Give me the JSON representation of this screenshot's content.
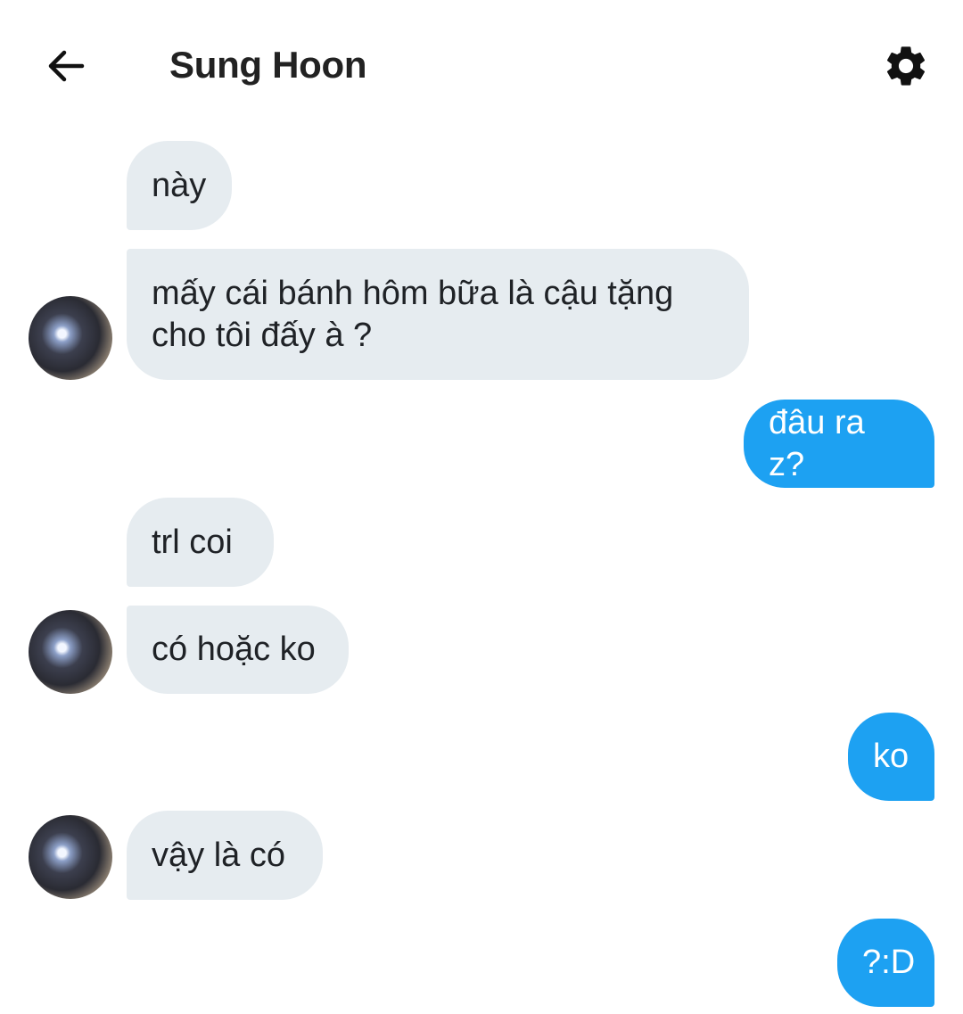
{
  "header": {
    "title": "Sung Hoon",
    "back_icon": "arrow-left-icon",
    "settings_icon": "gear-icon"
  },
  "colors": {
    "incoming_bubble": "#e6ecf0",
    "outgoing_bubble": "#1da1f2",
    "outgoing_text": "#ffffff"
  },
  "messages": [
    {
      "direction": "incoming",
      "text": "này"
    },
    {
      "direction": "incoming",
      "lines": [
        "mấy cái bánh hôm bữa là cậu tặng",
        "cho tôi đấy à ?"
      ]
    },
    {
      "direction": "outgoing",
      "text": "đâu ra z?"
    },
    {
      "direction": "incoming",
      "text": "trl coi"
    },
    {
      "direction": "incoming",
      "text": "có hoặc ko"
    },
    {
      "direction": "outgoing",
      "text": "ko"
    },
    {
      "direction": "incoming",
      "text": "vậy là có"
    },
    {
      "direction": "outgoing",
      "text": "?:D"
    }
  ]
}
